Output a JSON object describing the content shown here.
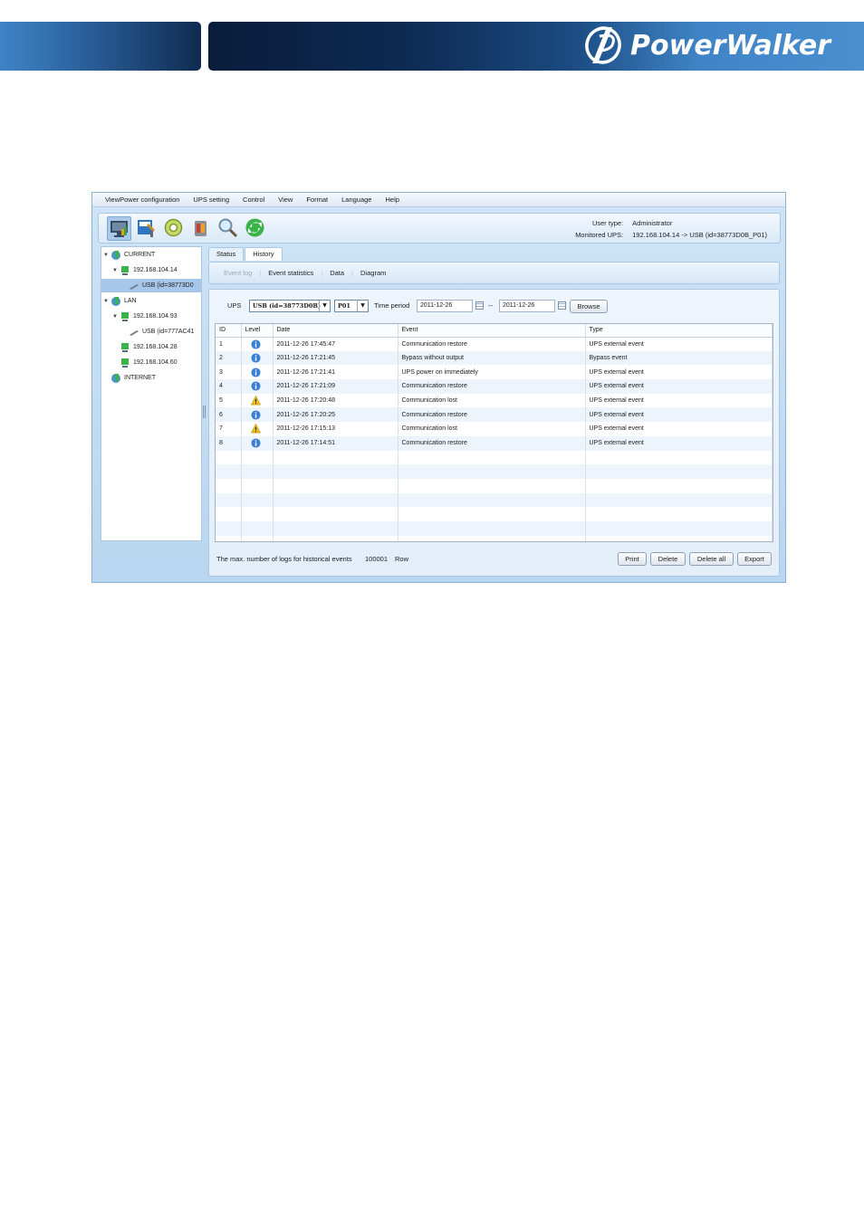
{
  "brand": {
    "name": "PowerWalker"
  },
  "menu": [
    "ViewPower configuration",
    "UPS setting",
    "Control",
    "View",
    "Format",
    "Language",
    "Help"
  ],
  "toolbar": {
    "icons": [
      "monitor-icon",
      "configuration-icon",
      "gear-icon",
      "shutdown-icon",
      "search-icon",
      "refresh-icon"
    ]
  },
  "user_info": {
    "user_type_label": "User type:",
    "user_type": "Administrator",
    "monitored_label": "Monitored UPS:",
    "monitored": "192.168.104.14 -> USB (id=38773D0B_P01)"
  },
  "tree": {
    "current": "CURRENT",
    "current_ip": "192.168.104.14",
    "current_usb": "USB (id=38773D0",
    "lan": "LAN",
    "lan_ip1": "192.168.104.93",
    "lan_usb": "USB (id=777AC41",
    "lan_ip2": "192.168.104.28",
    "lan_ip3": "192.168.104.60",
    "internet": "INTERNET"
  },
  "tabs": {
    "status": "Status",
    "history": "History"
  },
  "subtabs": {
    "event_log": "Event log",
    "event_statistics": "Event statistics",
    "data": "Data",
    "diagram": "Diagram"
  },
  "filter": {
    "ups_label": "UPS",
    "ups_value": "USB (id=38773D0B)",
    "port_value": "P01",
    "time_label": "Time period",
    "date_from": "2011-12-26",
    "separator": "--",
    "date_to": "2011-12-26",
    "browse": "Browse"
  },
  "table": {
    "columns": [
      "ID",
      "Level",
      "Date",
      "Event",
      "Type"
    ],
    "rows": [
      {
        "id": "1",
        "level": "info",
        "date": "2011-12-26 17:45:47",
        "event": "Communication restore",
        "type": "UPS external event"
      },
      {
        "id": "2",
        "level": "info",
        "date": "2011-12-26 17:21:45",
        "event": "Bypass without output",
        "type": "Bypass event"
      },
      {
        "id": "3",
        "level": "info",
        "date": "2011-12-26 17:21:41",
        "event": "UPS power on immediately",
        "type": "UPS external event"
      },
      {
        "id": "4",
        "level": "info",
        "date": "2011-12-26 17:21:09",
        "event": "Communication restore",
        "type": "UPS external event"
      },
      {
        "id": "5",
        "level": "warning",
        "date": "2011-12-26 17:20:48",
        "event": "Communication lost",
        "type": "UPS external event"
      },
      {
        "id": "6",
        "level": "info",
        "date": "2011-12-26 17:20:25",
        "event": "Communication restore",
        "type": "UPS external event"
      },
      {
        "id": "7",
        "level": "warning",
        "date": "2011-12-26 17:15:13",
        "event": "Communication lost",
        "type": "UPS external event"
      },
      {
        "id": "8",
        "level": "info",
        "date": "2011-12-26 17:14:51",
        "event": "Communication restore",
        "type": "UPS external event"
      }
    ],
    "empty_rows": 7
  },
  "footer": {
    "max_label": "The max. number of logs for historical events",
    "max_value": "100001",
    "unit": "Row",
    "print": "Print",
    "delete": "Delete",
    "delete_all": "Delete all",
    "export": "Export"
  },
  "colors": {
    "accent": "#3f84c6",
    "header_dark": "#0d2a52",
    "selected": "#a6c6ea"
  }
}
